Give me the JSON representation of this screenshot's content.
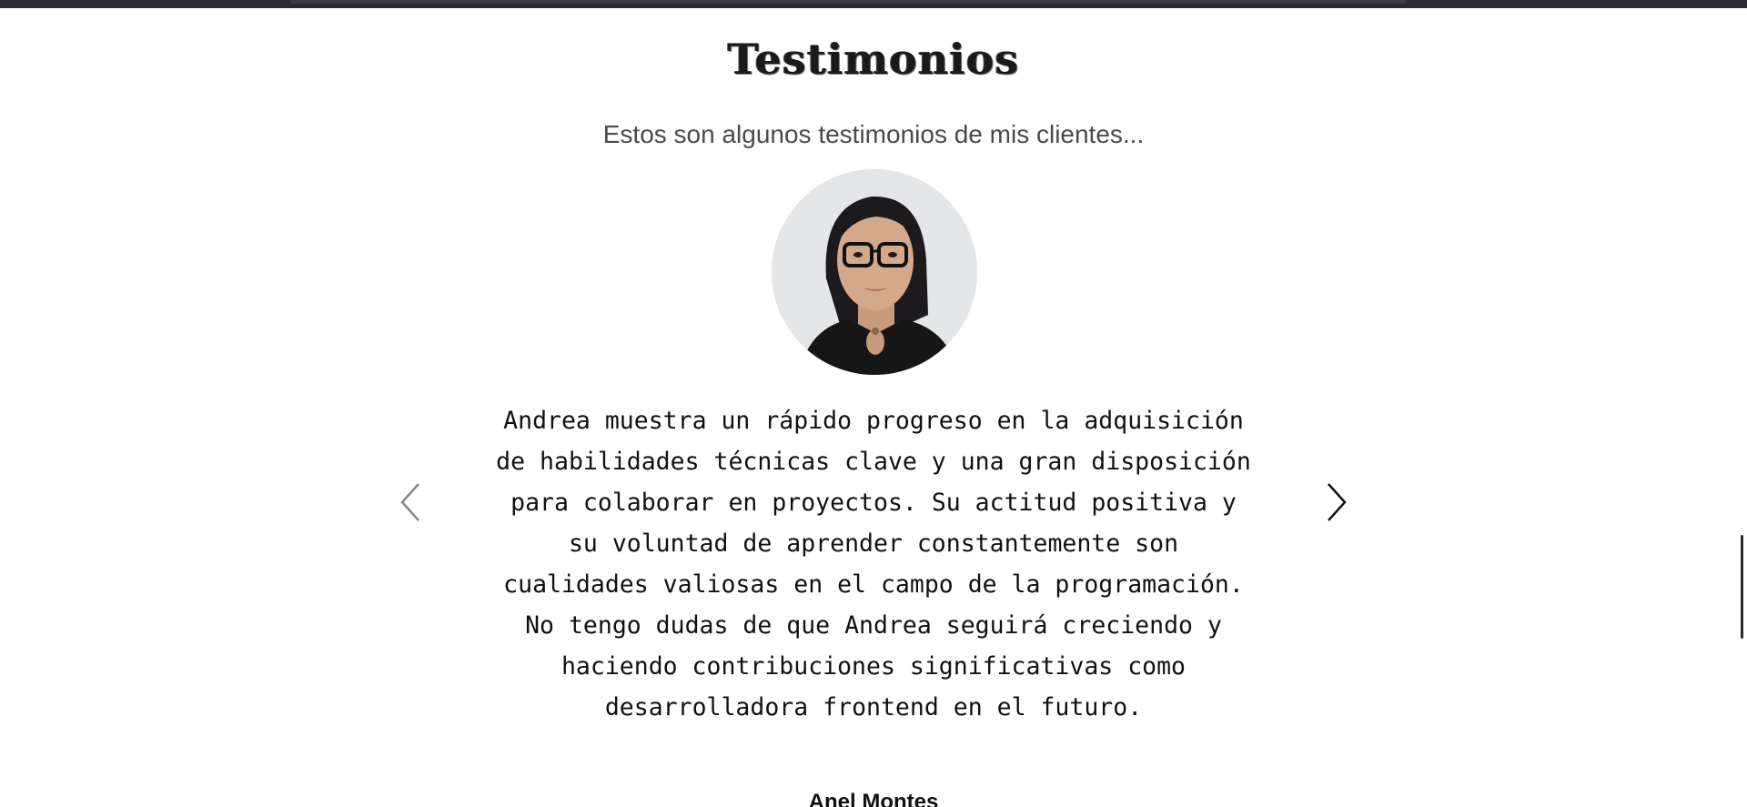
{
  "testimonials": {
    "title": "Testimonios",
    "subtitle": "Estos son algunos testimonios de mis clientes...",
    "quote": "Andrea muestra un rápido progreso en la adquisición de habilidades técnicas clave y una gran disposición para colaborar en proyectos. Su actitud positiva y su voluntad de aprender constantemente son cualidades valiosas en el campo de la programación. No tengo dudas de que Andrea seguirá creciendo y haciendo contribuciones significativas como desarrolladora frontend en el futuro.",
    "author": "Anel Montes",
    "prev_icon": "chevron-left-icon",
    "next_icon": "chevron-right-icon"
  },
  "colors": {
    "topbar": "#2a2830",
    "text": "#111111",
    "subtitle": "#4a4a4a",
    "background": "#ffffff"
  }
}
